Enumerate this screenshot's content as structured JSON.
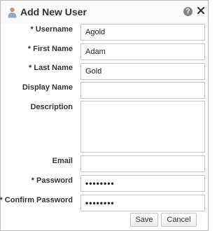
{
  "dialog": {
    "title": "Add New User",
    "icons": {
      "user": "user-icon",
      "help": "help-icon",
      "close": "close-icon"
    },
    "help_glyph": "?"
  },
  "form": {
    "username": {
      "label": "* Username",
      "value": "Agold"
    },
    "first_name": {
      "label": "* First Name",
      "value": "Adam"
    },
    "last_name": {
      "label": "* Last Name",
      "value": "Gold"
    },
    "display_name": {
      "label": "Display Name",
      "value": ""
    },
    "description": {
      "label": "Description",
      "value": ""
    },
    "email": {
      "label": "Email",
      "value": ""
    },
    "password": {
      "label": "* Password",
      "masked_value": "••••••••"
    },
    "confirm_password": {
      "label": "* Confirm Password",
      "masked_value": "••••••••"
    }
  },
  "buttons": {
    "save": "Save",
    "cancel": "Cancel"
  },
  "colors": {
    "label_text": "#333333",
    "border": "#c7c7c7",
    "help_icon": "#858585"
  }
}
